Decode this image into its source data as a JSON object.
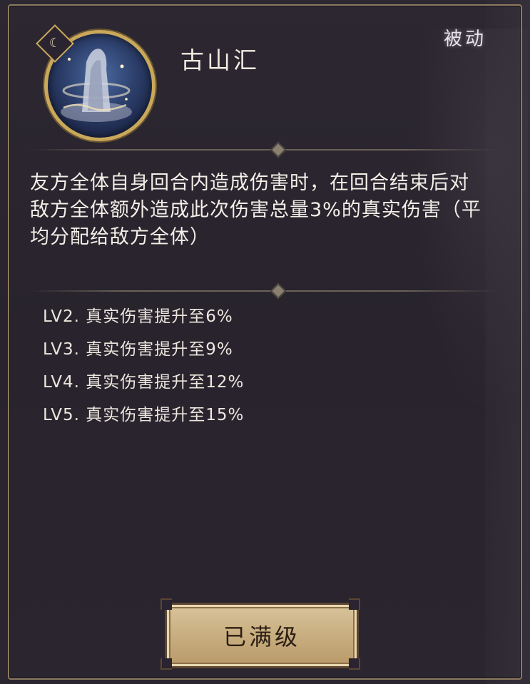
{
  "skill": {
    "name": "古山汇",
    "type_tag": "被动",
    "level_badge_icon": "moon-icon"
  },
  "description": "友方全体自身回合内造成伤害时，在回合结束后对敌方全体额外造成此次伤害总量3%的真实伤害（平均分配给敌方全体）",
  "level_upgrades": [
    "LV2. 真实伤害提升至6%",
    "LV3. 真实伤害提升至9%",
    "LV4. 真实伤害提升至12%",
    "LV5. 真实伤害提升至15%"
  ],
  "button": {
    "label": "已满级"
  },
  "colors": {
    "panel_bg": "#2a2530",
    "gold_border": "#c9a85a",
    "button_bg": "#c8ae80",
    "text_main": "#f3efe8"
  }
}
